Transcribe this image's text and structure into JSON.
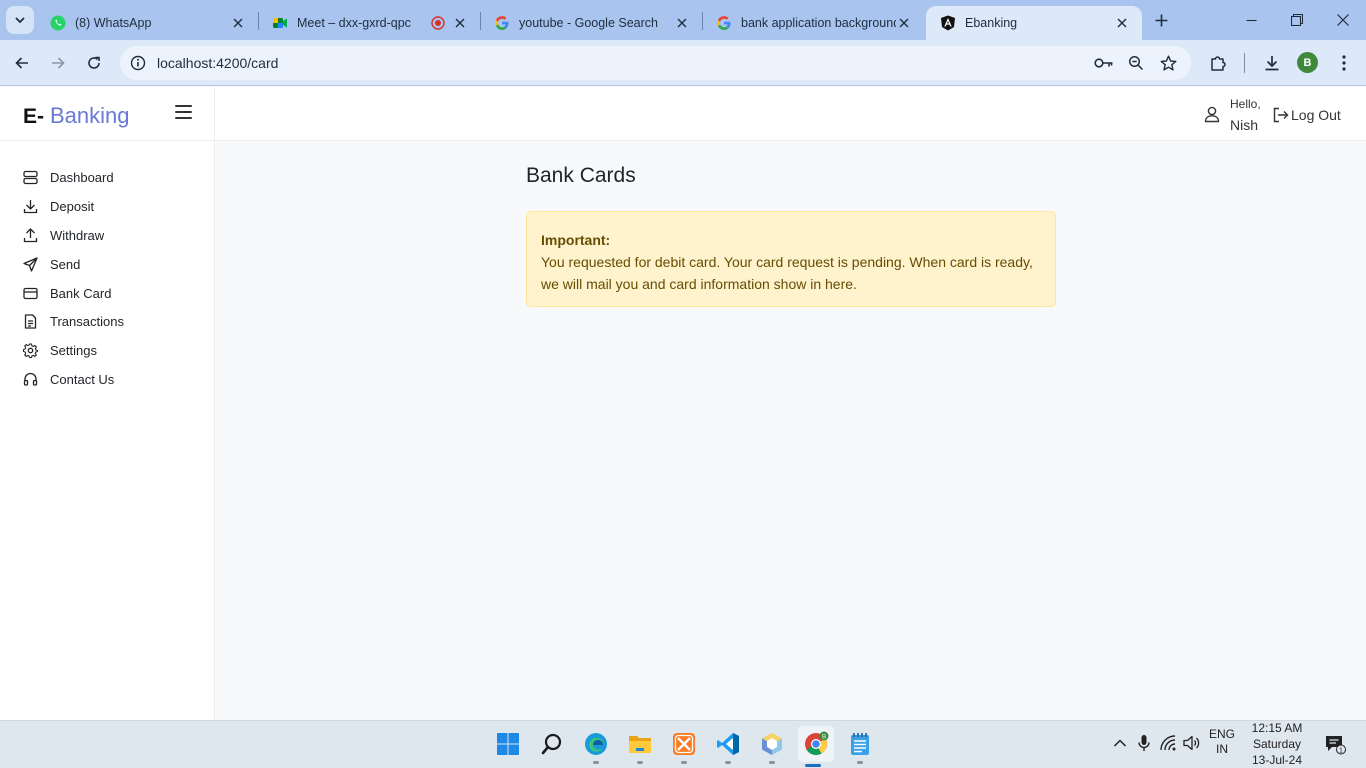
{
  "browser": {
    "tabs": [
      {
        "title": "(8) WhatsApp",
        "icon": "whatsapp-icon"
      },
      {
        "title": "Meet – dxx-gxrd-qpc",
        "icon": "google-meet-icon"
      },
      {
        "title": "youtube - Google Search",
        "icon": "google-icon"
      },
      {
        "title": "bank application background",
        "icon": "google-icon"
      },
      {
        "title": "Ebanking",
        "icon": "angular-icon"
      }
    ],
    "url": "localhost:4200/card",
    "profile_initial": "B"
  },
  "app": {
    "brand_prefix": "E-",
    "brand_name": "Banking",
    "greeting": "Hello,",
    "user_name": "Nish",
    "logout_label": "Log Out",
    "nav": [
      {
        "label": "Dashboard",
        "icon": "dashboard-icon"
      },
      {
        "label": "Deposit",
        "icon": "download-icon"
      },
      {
        "label": "Withdraw",
        "icon": "upload-icon"
      },
      {
        "label": "Send",
        "icon": "send-icon"
      },
      {
        "label": "Bank Card",
        "icon": "credit-card-icon"
      },
      {
        "label": "Transactions",
        "icon": "document-icon"
      },
      {
        "label": "Settings",
        "icon": "gear-icon"
      },
      {
        "label": "Contact Us",
        "icon": "headset-icon"
      }
    ],
    "page_title": "Bank Cards",
    "alert": {
      "heading": "Important:",
      "message": "You requested for debit card. Your card request is pending. When card is ready, we will mail you and card information show in here."
    }
  },
  "taskbar": {
    "language": "ENG",
    "region": "IN",
    "time": "12:15 AM",
    "day": "Saturday",
    "date": "13-Jul-24",
    "notification_count": "1"
  },
  "colors": {
    "brand": "#6a78d6",
    "alert_bg": "#fff3cd",
    "alert_text": "#664d03",
    "chrome_tabstrip": "#a9c5ef"
  }
}
